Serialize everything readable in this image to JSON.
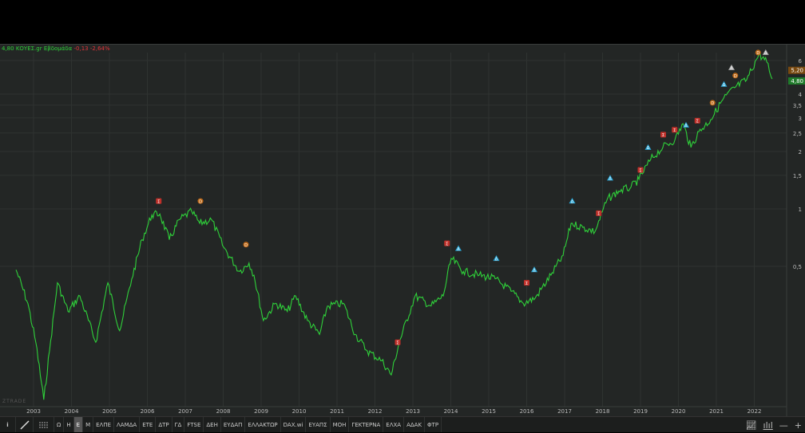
{
  "info": {
    "price": "4,80",
    "symbol": "ΚΟΥΕΣ.gr",
    "period": "Εβδομάδα",
    "change": "-0,13",
    "change_pct": "-2,64%"
  },
  "brand": "ZTRADE",
  "price_tags": {
    "previous": "5,20",
    "last": "4,80"
  },
  "toolbar": {
    "items": [
      "Ω",
      "Η",
      "Ε",
      "Μ",
      "ΕΛΠΕ",
      "ΛΑΜΔΑ",
      "ΕΤΕ",
      "ΔΤΡ",
      "ΓΔ",
      "FTSE",
      "ΔΕΗ",
      "ΕΥΔΑΠ",
      "ΕΛΛΑΚΤΩΡ",
      "DAX.wi",
      "ΕΥΑΠΣ",
      "ΜΟΗ",
      "ΓΕΚΤΕΡΝΑ",
      "ΕΛΧΑ",
      "ΑΔΑΚ",
      "ΦΤΡ"
    ],
    "active": "Ε"
  },
  "colors": {
    "line": "#2fd13a",
    "bg": "#232625",
    "grid": "#2f3331",
    "up": "#2fd13a",
    "down": "#e0343a",
    "tag_prev": "#7a4a10",
    "tag_last": "#1f7a2a"
  },
  "chart_data": {
    "type": "line",
    "scale": "log",
    "x_ticks": [
      "2003",
      "2004",
      "2005",
      "2006",
      "2007",
      "2008",
      "2009",
      "2010",
      "2011",
      "2012",
      "2013",
      "2014",
      "2015",
      "2016",
      "2017",
      "2018",
      "2019",
      "2020",
      "2021",
      "2022"
    ],
    "y_ticks": [
      "0,5",
      "1",
      "1,5",
      "2",
      "2,5",
      "3",
      "3,5",
      "4",
      "6"
    ],
    "y_tick_values": [
      0.5,
      1,
      1.5,
      2,
      2.5,
      3,
      3.5,
      4,
      6
    ],
    "x": [
      2002.54,
      2002.85,
      2003.06,
      2003.27,
      2003.42,
      2003.63,
      2003.91,
      2004.22,
      2004.64,
      2004.96,
      2005.27,
      2005.59,
      2005.86,
      2006.12,
      2006.33,
      2006.58,
      2006.85,
      2007.17,
      2007.38,
      2007.69,
      2008.01,
      2008.43,
      2008.68,
      2008.81,
      2009.06,
      2009.38,
      2009.69,
      2009.91,
      2010.22,
      2010.54,
      2010.75,
      2011.17,
      2011.48,
      2011.8,
      2012.18,
      2012.43,
      2012.64,
      2013.06,
      2013.48,
      2013.8,
      2014.01,
      2014.33,
      2014.75,
      2015.17,
      2015.59,
      2015.91,
      2016.22,
      2016.64,
      2016.96,
      2017.17,
      2017.48,
      2017.8,
      2018.12,
      2018.43,
      2018.75,
      2018.96,
      2019.27,
      2019.59,
      2019.91,
      2020.12,
      2020.33,
      2020.54,
      2020.85,
      2021.17,
      2021.48,
      2021.8,
      2022.12,
      2022.33,
      2022.47
    ],
    "y": [
      0.48,
      0.32,
      0.2,
      0.1,
      0.18,
      0.41,
      0.29,
      0.35,
      0.2,
      0.41,
      0.23,
      0.43,
      0.69,
      0.93,
      0.94,
      0.69,
      0.88,
      0.97,
      0.84,
      0.88,
      0.63,
      0.47,
      0.52,
      0.45,
      0.26,
      0.32,
      0.29,
      0.35,
      0.26,
      0.22,
      0.31,
      0.32,
      0.22,
      0.18,
      0.16,
      0.135,
      0.2,
      0.35,
      0.31,
      0.35,
      0.55,
      0.47,
      0.45,
      0.43,
      0.37,
      0.32,
      0.34,
      0.45,
      0.57,
      0.84,
      0.8,
      0.76,
      1.12,
      1.24,
      1.3,
      1.43,
      1.82,
      2.1,
      2.31,
      2.8,
      2.1,
      2.54,
      2.94,
      3.74,
      4.32,
      4.75,
      6.47,
      5.88,
      4.8
    ],
    "markers": [
      {
        "x": 2006.3,
        "y": 1.1,
        "label": "Σ",
        "color": "#c0302a"
      },
      {
        "x": 2007.4,
        "y": 1.1,
        "label": "D",
        "color": "#c06a18"
      },
      {
        "x": 2008.6,
        "y": 0.65,
        "label": "D",
        "color": "#c06a18"
      },
      {
        "x": 2012.6,
        "y": 0.2,
        "label": "Σ",
        "color": "#c0302a"
      },
      {
        "x": 2013.9,
        "y": 0.66,
        "label": "Σ",
        "color": "#c0302a"
      },
      {
        "x": 2014.2,
        "y": 0.62,
        "label": "Δ",
        "color": "#2aa8d8"
      },
      {
        "x": 2015.2,
        "y": 0.55,
        "label": "Δ",
        "color": "#2aa8d8"
      },
      {
        "x": 2016.0,
        "y": 0.41,
        "label": "Σ",
        "color": "#c0302a"
      },
      {
        "x": 2016.2,
        "y": 0.48,
        "label": "Δ",
        "color": "#2aa8d8"
      },
      {
        "x": 2017.2,
        "y": 1.1,
        "label": "Δ",
        "color": "#2aa8d8"
      },
      {
        "x": 2017.9,
        "y": 0.95,
        "label": "Σ",
        "color": "#c0302a"
      },
      {
        "x": 2018.2,
        "y": 1.45,
        "label": "Δ",
        "color": "#2aa8d8"
      },
      {
        "x": 2019.0,
        "y": 1.6,
        "label": "Σ",
        "color": "#c0302a"
      },
      {
        "x": 2019.2,
        "y": 2.1,
        "label": "Δ",
        "color": "#2aa8d8"
      },
      {
        "x": 2019.6,
        "y": 2.45,
        "label": "Σ",
        "color": "#c0302a"
      },
      {
        "x": 2019.9,
        "y": 2.6,
        "label": "Σ",
        "color": "#c0302a"
      },
      {
        "x": 2020.2,
        "y": 2.75,
        "label": "Δ",
        "color": "#2aa8d8"
      },
      {
        "x": 2020.5,
        "y": 2.9,
        "label": "Σ",
        "color": "#c0302a"
      },
      {
        "x": 2020.9,
        "y": 3.6,
        "label": "D",
        "color": "#c06a18"
      },
      {
        "x": 2021.2,
        "y": 4.5,
        "label": "Δ",
        "color": "#2aa8d8"
      },
      {
        "x": 2021.4,
        "y": 5.5,
        "label": "Δ",
        "color": "#aaaaaa"
      },
      {
        "x": 2021.5,
        "y": 5.0,
        "label": "D",
        "color": "#c06a18"
      },
      {
        "x": 2022.1,
        "y": 6.6,
        "label": "D",
        "color": "#c06a18"
      },
      {
        "x": 2022.3,
        "y": 6.6,
        "label": "Δ",
        "color": "#aaaaaa"
      }
    ]
  }
}
